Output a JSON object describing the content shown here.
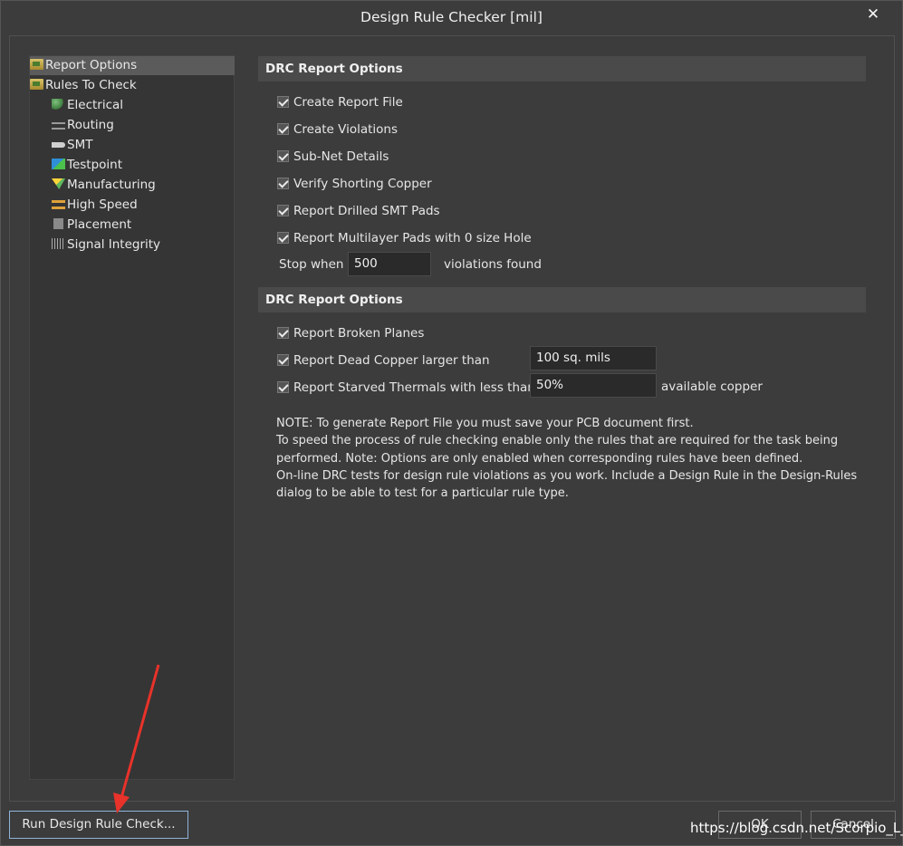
{
  "window": {
    "title": "Design Rule Checker [mil]",
    "close_glyph": "✕"
  },
  "tree": {
    "items": [
      {
        "label": "Report Options",
        "icon": "folder-icon",
        "selected": true
      },
      {
        "label": "Rules To Check",
        "icon": "folder-icon"
      },
      {
        "label": "Electrical",
        "icon": "electrical-icon"
      },
      {
        "label": "Routing",
        "icon": "routing-icon"
      },
      {
        "label": "SMT",
        "icon": "smt-icon"
      },
      {
        "label": "Testpoint",
        "icon": "testpoint-icon"
      },
      {
        "label": "Manufacturing",
        "icon": "manufacturing-icon"
      },
      {
        "label": "High Speed",
        "icon": "high-speed-icon"
      },
      {
        "label": "Placement",
        "icon": "placement-icon"
      },
      {
        "label": "Signal Integrity",
        "icon": "signal-integrity-icon"
      }
    ]
  },
  "section1": {
    "header": "DRC Report Options",
    "checkboxes": [
      {
        "label": "Create Report File",
        "checked": true
      },
      {
        "label": "Create Violations",
        "checked": true
      },
      {
        "label": "Sub-Net Details",
        "checked": true
      },
      {
        "label": "Verify Shorting Copper",
        "checked": true
      },
      {
        "label": "Report Drilled SMT Pads",
        "checked": true
      },
      {
        "label": "Report Multilayer Pads with 0 size Hole",
        "checked": true
      }
    ],
    "stop_when_label": "Stop when",
    "stop_when_value": "500",
    "violations_found_label": "violations found"
  },
  "section2": {
    "header": "DRC Report Options",
    "checkboxes": [
      {
        "label": "Report Broken Planes",
        "checked": true
      },
      {
        "label": "Report Dead Copper larger than",
        "checked": true
      },
      {
        "label": "Report Starved Thermals with less than",
        "checked": true
      }
    ],
    "dead_copper_value": "100 sq. mils",
    "starved_thermals_value": "50%",
    "available_copper_label": "available copper"
  },
  "note": {
    "lines": [
      "NOTE: To generate Report File you must save your PCB document first.",
      "To speed the process of rule checking enable only the rules that are required for the task being",
      "performed.  Note: Options are only enabled when corresponding rules have been defined.",
      "On-line DRC tests for design rule violations as you work. Include a Design Rule in the Design-Rules",
      "dialog to be able to test for a particular rule  type."
    ]
  },
  "buttons": {
    "run": "Run Design Rule Check...",
    "ok": "OK",
    "cancel": "Cancel"
  },
  "watermark": "https://blog.csdn.net/Scorpio_L_",
  "colors": {
    "background": "#3c3c3c",
    "panel": "#353535",
    "selection": "#5b5b5b",
    "annotation_arrow": "#e8322a"
  }
}
